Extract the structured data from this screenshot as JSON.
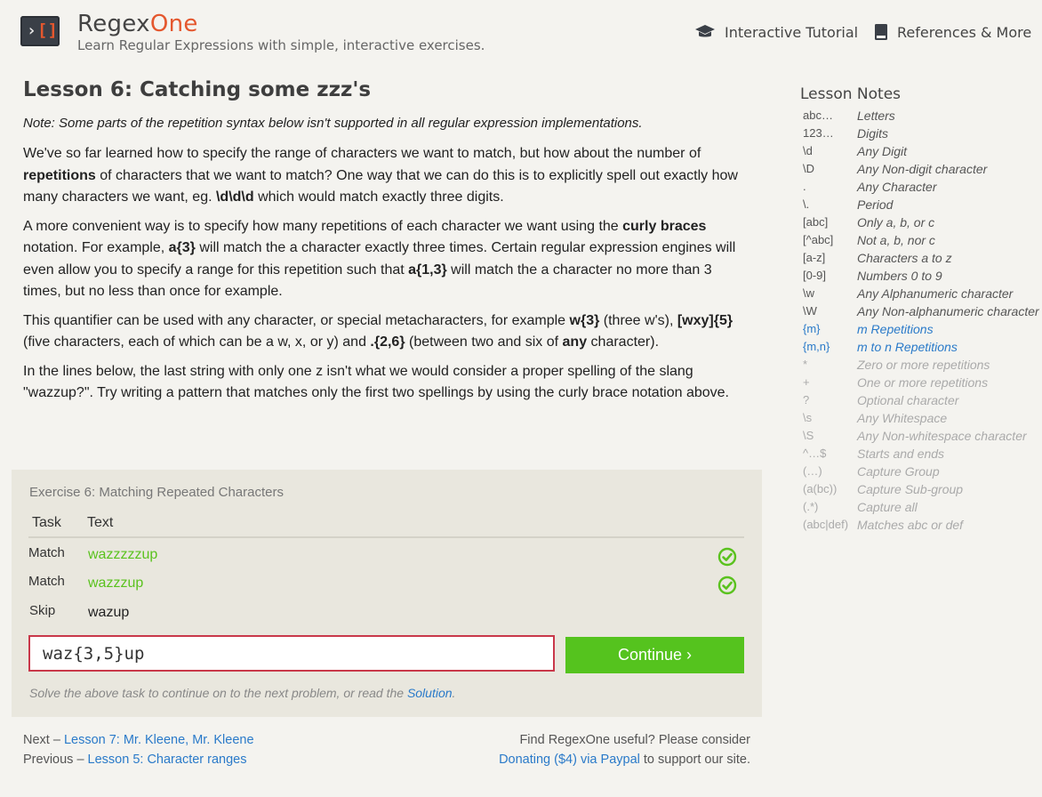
{
  "header": {
    "logo_glyph_left": "›",
    "logo_glyph_right": "[]",
    "brand_part1": "Regex",
    "brand_part2": "One",
    "tagline": "Learn Regular Expressions with simple, interactive exercises.",
    "nav_tutorial": "Interactive Tutorial",
    "nav_references": "References & More"
  },
  "lesson": {
    "title": "Lesson 6: Catching some zzz's",
    "note": "Note: Some parts of the repetition syntax below isn't supported in all regular expression implementations.",
    "p1": {
      "a": "We've so far learned how to specify the range of characters we want to match, but how about the number of ",
      "b": "repetitions",
      "c": " of characters that we want to match? One way that we can do this is to explicitly spell out exactly how many characters we want, eg. ",
      "d": "\\d\\d\\d",
      "e": " which would match exactly three digits."
    },
    "p2": {
      "a": "A more convenient way is to specify how many repetitions of each character we want using the ",
      "b": "curly braces",
      "c": " notation. For example, ",
      "d": "a{3}",
      "e": " will match the a character exactly three times. Certain regular expression engines will even allow you to specify a range for this repetition such that ",
      "f": "a{1,3}",
      "g": " will match the a character no more than 3 times, but no less than once for example."
    },
    "p3": {
      "a": "This quantifier can be used with any character, or special metacharacters, for example ",
      "b": "w{3}",
      "c": " (three w's), ",
      "d": "[wxy]{5}",
      "e": " (five characters, each of which can be a w, x, or y) and ",
      "f": ".{2,6}",
      "g": " (between two and six of ",
      "h": "any",
      "i": " character)."
    },
    "p4": "In the lines below, the last string with only one z isn't what we would consider a proper spelling of the slang \"wazzup?\". Try writing a pattern that matches only the first two spellings by using the curly brace notation above."
  },
  "exercise": {
    "title": "Exercise 6: Matching Repeated Characters",
    "col_task": "Task",
    "col_text": "Text",
    "rows": [
      {
        "task": "Match",
        "text": "wazzzzzup"
      },
      {
        "task": "Match",
        "text": "wazzzup"
      },
      {
        "task": "Skip",
        "text": "wazup"
      }
    ],
    "answer_value": "waz{3,5}up",
    "continue_label": "Continue ›",
    "hint_text": "Solve the above task to continue on to the next problem, or read the ",
    "hint_link": "Solution",
    "hint_end": "."
  },
  "footer": {
    "next_prefix": "Next – ",
    "next_link": "Lesson 7: Mr. Kleene, Mr. Kleene",
    "prev_prefix": "Previous – ",
    "prev_link": "Lesson 5: Character ranges",
    "support_text": "Find RegexOne useful? Please consider",
    "donate_link": "Donating ($4) via Paypal",
    "donate_suffix": " to support our site."
  },
  "notes": {
    "title": "Lesson Notes",
    "items": [
      {
        "key": "abc…",
        "value": "Letters",
        "state": "done"
      },
      {
        "key": "123…",
        "value": "Digits",
        "state": "done"
      },
      {
        "key": "\\d",
        "value": "Any Digit",
        "state": "done"
      },
      {
        "key": "\\D",
        "value": "Any Non-digit character",
        "state": "done"
      },
      {
        "key": ".",
        "value": "Any Character",
        "state": "done"
      },
      {
        "key": "\\.",
        "value": "Period",
        "state": "done"
      },
      {
        "key": "[abc]",
        "value": "Only a, b, or c",
        "state": "done"
      },
      {
        "key": "[^abc]",
        "value": "Not a, b, nor c",
        "state": "done"
      },
      {
        "key": "[a-z]",
        "value": "Characters a to z",
        "state": "done"
      },
      {
        "key": "[0-9]",
        "value": "Numbers 0 to 9",
        "state": "done"
      },
      {
        "key": "\\w",
        "value": "Any Alphanumeric character",
        "state": "done"
      },
      {
        "key": "\\W",
        "value": "Any Non-alphanumeric character",
        "state": "done"
      },
      {
        "key": "{m}",
        "value": "m Repetitions",
        "state": "current"
      },
      {
        "key": "{m,n}",
        "value": "m to n Repetitions",
        "state": "current"
      },
      {
        "key": "*",
        "value": "Zero or more repetitions",
        "state": "future"
      },
      {
        "key": "+",
        "value": "One or more repetitions",
        "state": "future"
      },
      {
        "key": "?",
        "value": "Optional character",
        "state": "future"
      },
      {
        "key": "\\s",
        "value": "Any Whitespace",
        "state": "future"
      },
      {
        "key": "\\S",
        "value": "Any Non-whitespace character",
        "state": "future"
      },
      {
        "key": "^…$",
        "value": "Starts and ends",
        "state": "future"
      },
      {
        "key": "(…)",
        "value": "Capture Group",
        "state": "future"
      },
      {
        "key": "(a(bc))",
        "value": "Capture Sub-group",
        "state": "future"
      },
      {
        "key": "(.*)",
        "value": "Capture all",
        "state": "future"
      },
      {
        "key": "(abc|def)",
        "value": "Matches abc or def",
        "state": "future"
      }
    ]
  },
  "colors": {
    "match_green": "#5ac21e",
    "continue_green": "#55c31e",
    "link_blue": "#2a7ac9",
    "brand_orange": "#e4572e",
    "input_border_red": "#c9384a"
  },
  "icons": {
    "tutorial": "graduation-cap-icon",
    "references": "book-icon",
    "row_status": "check-circle-icon"
  }
}
